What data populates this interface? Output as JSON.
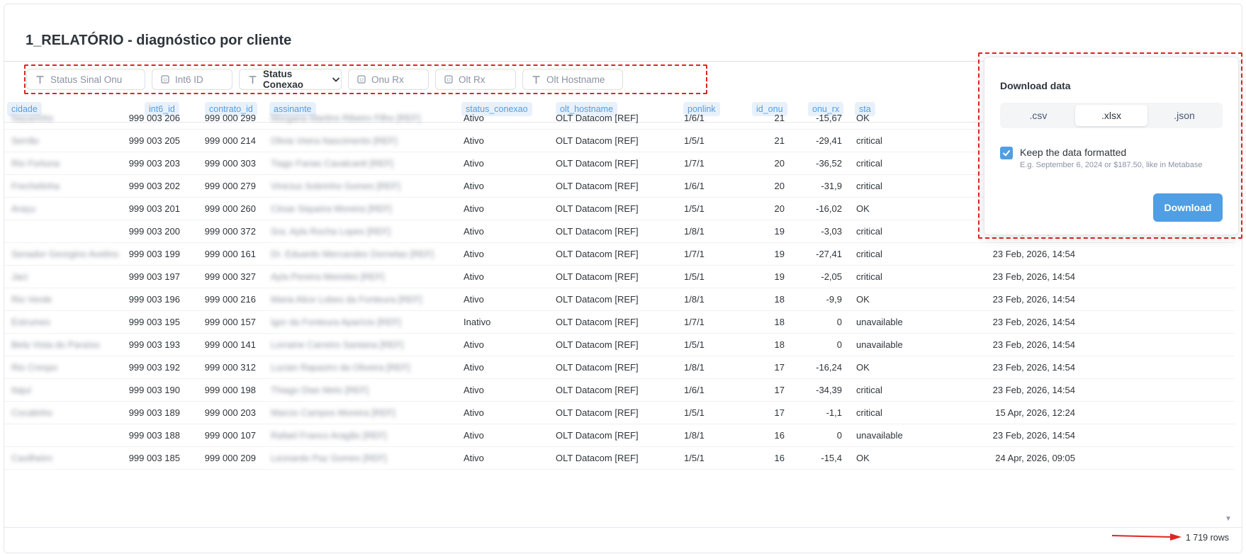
{
  "title": "1_RELATÓRIO - diagnóstico por cliente",
  "filters": [
    {
      "label": "Status Sinal Onu",
      "icon": "text-type-icon"
    },
    {
      "label": "Int6 ID",
      "icon": "number-type-icon"
    },
    {
      "label": "Status Conexao",
      "icon": "text-type-icon",
      "selected": true
    },
    {
      "label": "Onu Rx",
      "icon": "number-type-icon"
    },
    {
      "label": "Olt Rx",
      "icon": "number-type-icon"
    },
    {
      "label": "Olt Hostname",
      "icon": "text-type-icon"
    }
  ],
  "columns": [
    "cidade",
    "int6_id",
    "contrato_id",
    "assinante",
    "status_conexao",
    "olt_hostname",
    "ponlink",
    "id_onu",
    "onu_rx",
    "sta"
  ],
  "rows": [
    {
      "cidade": "Nazarinho",
      "int6_id": "999 003 206",
      "contrato_id": "999 000 299",
      "assinante": "Morgana Martins Ribeiro Filho [REF]",
      "status_conexao": "Ativo",
      "olt_hostname": "OLT Datacom [REF]",
      "ponlink": "1/6/1",
      "id_onu": "21",
      "onu_rx": "-15,67",
      "status": "OK",
      "updated": ""
    },
    {
      "cidade": "Serrão",
      "int6_id": "999 003 205",
      "contrato_id": "999 000 214",
      "assinante": "Olivia Vieira Nascimento [REF]",
      "status_conexao": "Ativo",
      "olt_hostname": "OLT Datacom [REF]",
      "ponlink": "1/5/1",
      "id_onu": "21",
      "onu_rx": "-29,41",
      "status": "critical",
      "updated": ""
    },
    {
      "cidade": "Rio Fortuna",
      "int6_id": "999 003 203",
      "contrato_id": "999 000 303",
      "assinante": "Tiago Farias Cavalcanti [REF]",
      "status_conexao": "Ativo",
      "olt_hostname": "OLT Datacom [REF]",
      "ponlink": "1/7/1",
      "id_onu": "20",
      "onu_rx": "-36,52",
      "status": "critical",
      "updated": ""
    },
    {
      "cidade": "Frechelinha",
      "int6_id": "999 003 202",
      "contrato_id": "999 000 279",
      "assinante": "Vinicius Sobrinho Gomes [REF]",
      "status_conexao": "Ativo",
      "olt_hostname": "OLT Datacom [REF]",
      "ponlink": "1/6/1",
      "id_onu": "20",
      "onu_rx": "-31,9",
      "status": "critical",
      "updated": ""
    },
    {
      "cidade": "Araçu",
      "int6_id": "999 003 201",
      "contrato_id": "999 000 260",
      "assinante": "César Siqueira Moreira [REF]",
      "status_conexao": "Ativo",
      "olt_hostname": "OLT Datacom [REF]",
      "ponlink": "1/5/1",
      "id_onu": "20",
      "onu_rx": "-16,02",
      "status": "OK",
      "updated": ""
    },
    {
      "cidade": "",
      "int6_id": "999 003 200",
      "contrato_id": "999 000 372",
      "assinante": "Sra. Ayla Rocha Lopes [REF]",
      "status_conexao": "Ativo",
      "olt_hostname": "OLT Datacom [REF]",
      "ponlink": "1/8/1",
      "id_onu": "19",
      "onu_rx": "-3,03",
      "status": "critical",
      "updated": "23 Feb, 2026, 14:54"
    },
    {
      "cidade": "Senador Georgino Avelino",
      "int6_id": "999 003 199",
      "contrato_id": "999 000 161",
      "assinante": "Dr. Eduardo Mercandes Dornelas [REF]",
      "status_conexao": "Ativo",
      "olt_hostname": "OLT Datacom [REF]",
      "ponlink": "1/7/1",
      "id_onu": "19",
      "onu_rx": "-27,41",
      "status": "critical",
      "updated": "23 Feb, 2026, 14:54"
    },
    {
      "cidade": "Jaci",
      "int6_id": "999 003 197",
      "contrato_id": "999 000 327",
      "assinante": "Ayla Pereira Meireles [REF]",
      "status_conexao": "Ativo",
      "olt_hostname": "OLT Datacom [REF]",
      "ponlink": "1/5/1",
      "id_onu": "19",
      "onu_rx": "-2,05",
      "status": "critical",
      "updated": "23 Feb, 2026, 14:54"
    },
    {
      "cidade": "Rio Verde",
      "int6_id": "999 003 196",
      "contrato_id": "999 000 216",
      "assinante": "Maria Alice Lobes da Fonteura [REF]",
      "status_conexao": "Ativo",
      "olt_hostname": "OLT Datacom [REF]",
      "ponlink": "1/8/1",
      "id_onu": "18",
      "onu_rx": "-9,9",
      "status": "OK",
      "updated": "23 Feb, 2026, 14:54"
    },
    {
      "cidade": "Estrumes",
      "int6_id": "999 003 195",
      "contrato_id": "999 000 157",
      "assinante": "Igor da Fonteura Aparício [REF]",
      "status_conexao": "Inativo",
      "olt_hostname": "OLT Datacom [REF]",
      "ponlink": "1/7/1",
      "id_onu": "18",
      "onu_rx": "0",
      "status": "unavailable",
      "updated": "23 Feb, 2026, 14:54"
    },
    {
      "cidade": "Bela Vista do Paraíso",
      "int6_id": "999 003 193",
      "contrato_id": "999 000 141",
      "assinante": "Lorraine Carreiro Santana [REF]",
      "status_conexao": "Ativo",
      "olt_hostname": "OLT Datacom [REF]",
      "ponlink": "1/5/1",
      "id_onu": "18",
      "onu_rx": "0",
      "status": "unavailable",
      "updated": "23 Feb, 2026, 14:54"
    },
    {
      "cidade": "Rio Crespo",
      "int6_id": "999 003 192",
      "contrato_id": "999 000 312",
      "assinante": "Lucian Rapaziro da Oliveira [REF]",
      "status_conexao": "Ativo",
      "olt_hostname": "OLT Datacom [REF]",
      "ponlink": "1/8/1",
      "id_onu": "17",
      "onu_rx": "-16,24",
      "status": "OK",
      "updated": "23 Feb, 2026, 14:54"
    },
    {
      "cidade": "Itajuí",
      "int6_id": "999 003 190",
      "contrato_id": "999 000 198",
      "assinante": "Thiago Dias Melo [REF]",
      "status_conexao": "Ativo",
      "olt_hostname": "OLT Datacom [REF]",
      "ponlink": "1/6/1",
      "id_onu": "17",
      "onu_rx": "-34,39",
      "status": "critical",
      "updated": "23 Feb, 2026, 14:54"
    },
    {
      "cidade": "Cocalinho",
      "int6_id": "999 003 189",
      "contrato_id": "999 000 203",
      "assinante": "Marcio Campos Moreira [REF]",
      "status_conexao": "Ativo",
      "olt_hostname": "OLT Datacom [REF]",
      "ponlink": "1/5/1",
      "id_onu": "17",
      "onu_rx": "-1,1",
      "status": "critical",
      "updated": "15 Apr, 2026, 12:24"
    },
    {
      "cidade": "",
      "int6_id": "999 003 188",
      "contrato_id": "999 000 107",
      "assinante": "Rafael Franco Aragão [REF]",
      "status_conexao": "Ativo",
      "olt_hostname": "OLT Datacom [REF]",
      "ponlink": "1/8/1",
      "id_onu": "16",
      "onu_rx": "0",
      "status": "unavailable",
      "updated": "23 Feb, 2026, 14:54"
    },
    {
      "cidade": "Cavilheiro",
      "int6_id": "999 003 185",
      "contrato_id": "999 000 209",
      "assinante": "Leonardo Paz Gomes [REF]",
      "status_conexao": "Ativo",
      "olt_hostname": "OLT Datacom [REF]",
      "ponlink": "1/5/1",
      "id_onu": "16",
      "onu_rx": "-15,4",
      "status": "OK",
      "updated": "24 Apr, 2026, 09:05"
    }
  ],
  "row_count": "1 719 rows",
  "download": {
    "title": "Download data",
    "formats": [
      ".csv",
      ".xlsx",
      ".json"
    ],
    "selected_format": ".xlsx",
    "keep_formatted_label": "Keep the data formatted",
    "keep_formatted_hint": "E.g. September 6, 2024 or $187.50, like in Metabase",
    "keep_formatted": true,
    "button_label": "Download"
  },
  "colors": {
    "accent": "#509ee3",
    "annotation": "#e02424",
    "header_bg": "#e8f1fb"
  }
}
